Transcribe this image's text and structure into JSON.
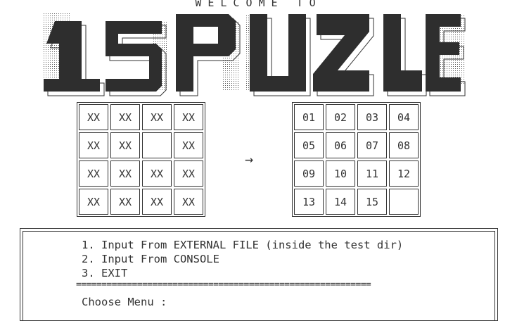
{
  "header": {
    "welcome": "WELCOME TO",
    "banner_text": "15 PUZZLE"
  },
  "start_board": {
    "cells": [
      "XX",
      "XX",
      "XX",
      "XX",
      "XX",
      "XX",
      "",
      "XX",
      "XX",
      "XX",
      "XX",
      "XX",
      "XX",
      "XX",
      "XX",
      "XX"
    ]
  },
  "arrow": "→",
  "goal_board": {
    "cells": [
      "01",
      "02",
      "03",
      "04",
      "05",
      "06",
      "07",
      "08",
      "09",
      "10",
      "11",
      "12",
      "13",
      "14",
      "15",
      ""
    ]
  },
  "menu": {
    "items": [
      "1. Input From EXTERNAL FILE (inside the test dir)",
      "2. Input From CONSOLE",
      "3. EXIT"
    ],
    "divider": "==========================================================",
    "prompt": "Choose Menu :"
  },
  "colors": {
    "text": "#333333",
    "block_fill": "#2e2e2e",
    "background": "#ffffff"
  }
}
